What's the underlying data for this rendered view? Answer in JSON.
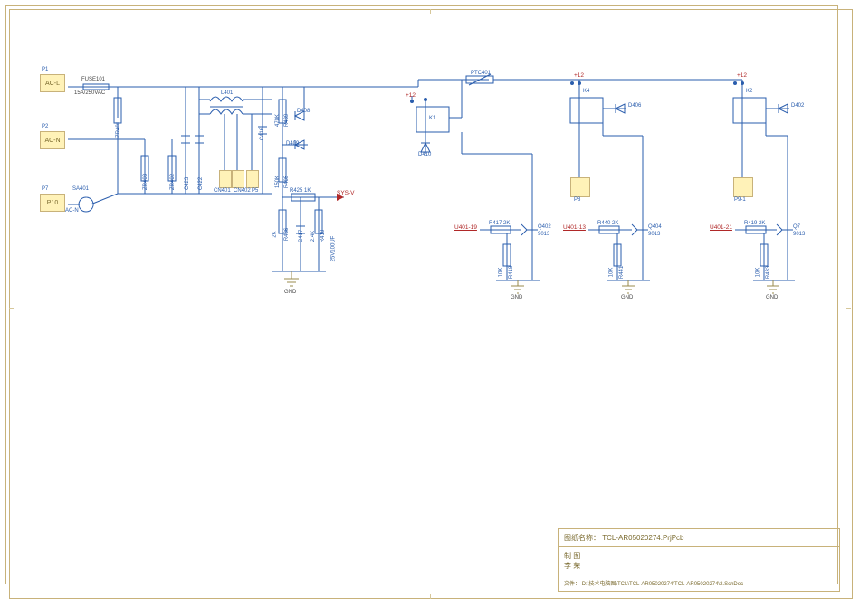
{
  "title_block": {
    "name_label": "图纸名称：",
    "name_value": "TCL-AR05020274.PrjPcb",
    "drawn_label": "制    图",
    "drawn_by": "李 荣",
    "file_label": "文件：",
    "file_value": "D:\\技术电脑图\\TCL\\TCL-AR05020274\\TCL-AR05020274\\2.SchDoc"
  },
  "ports": {
    "p1": "P1",
    "p1_net": "AC-L",
    "p2": "P2",
    "p2_net": "AC-N",
    "p7": "P7",
    "p7_alt": "P10",
    "p7_net": "AC-N",
    "p8": "P8",
    "p9": "P9-1"
  },
  "components": {
    "fuse": "FUSE101",
    "fuse_rate": "15A/250VAC",
    "sa401": "SA401",
    "zr401": "ZR401",
    "zr402": "ZR402",
    "zr403": "ZR403",
    "c422": "C422",
    "c423": "C423",
    "l401": "L401",
    "c416": "C416",
    "cn401": "CN401",
    "cn402": "CN402",
    "p5": "P5",
    "r439": "R439",
    "r439_val": "470K",
    "d408": "D408",
    "d409": "D409",
    "r405": "R405",
    "r405_val": "150K",
    "r425": "R425  1K",
    "r436": "R436",
    "r436_val": "2K",
    "c417": "C417",
    "r410": "R410",
    "r410_val": "2.4K",
    "c417_val": "25V100UF",
    "sysv": "SYS-V",
    "ptc401": "PTC401",
    "plus12_a": "+12",
    "plus12_b": "+12",
    "plus12_c": "+12",
    "k1": "K1",
    "k4": "K4",
    "k2": "K2",
    "d410": "D410",
    "d406": "D406",
    "d402": "D402",
    "u_a": "U401-19",
    "u_b": "U401-13",
    "u_c": "U401-21",
    "r417": "R417   2K",
    "r440": "R440   2K",
    "r419": "R419   2K",
    "r418": "R418",
    "r418_val": "10K",
    "r441": "R441",
    "r441_val": "10K",
    "r433": "R433",
    "r433_val": "10K",
    "q402": "Q402",
    "q404": "Q404",
    "q7": "Q7",
    "qval": "9013",
    "gnd": "GND"
  }
}
